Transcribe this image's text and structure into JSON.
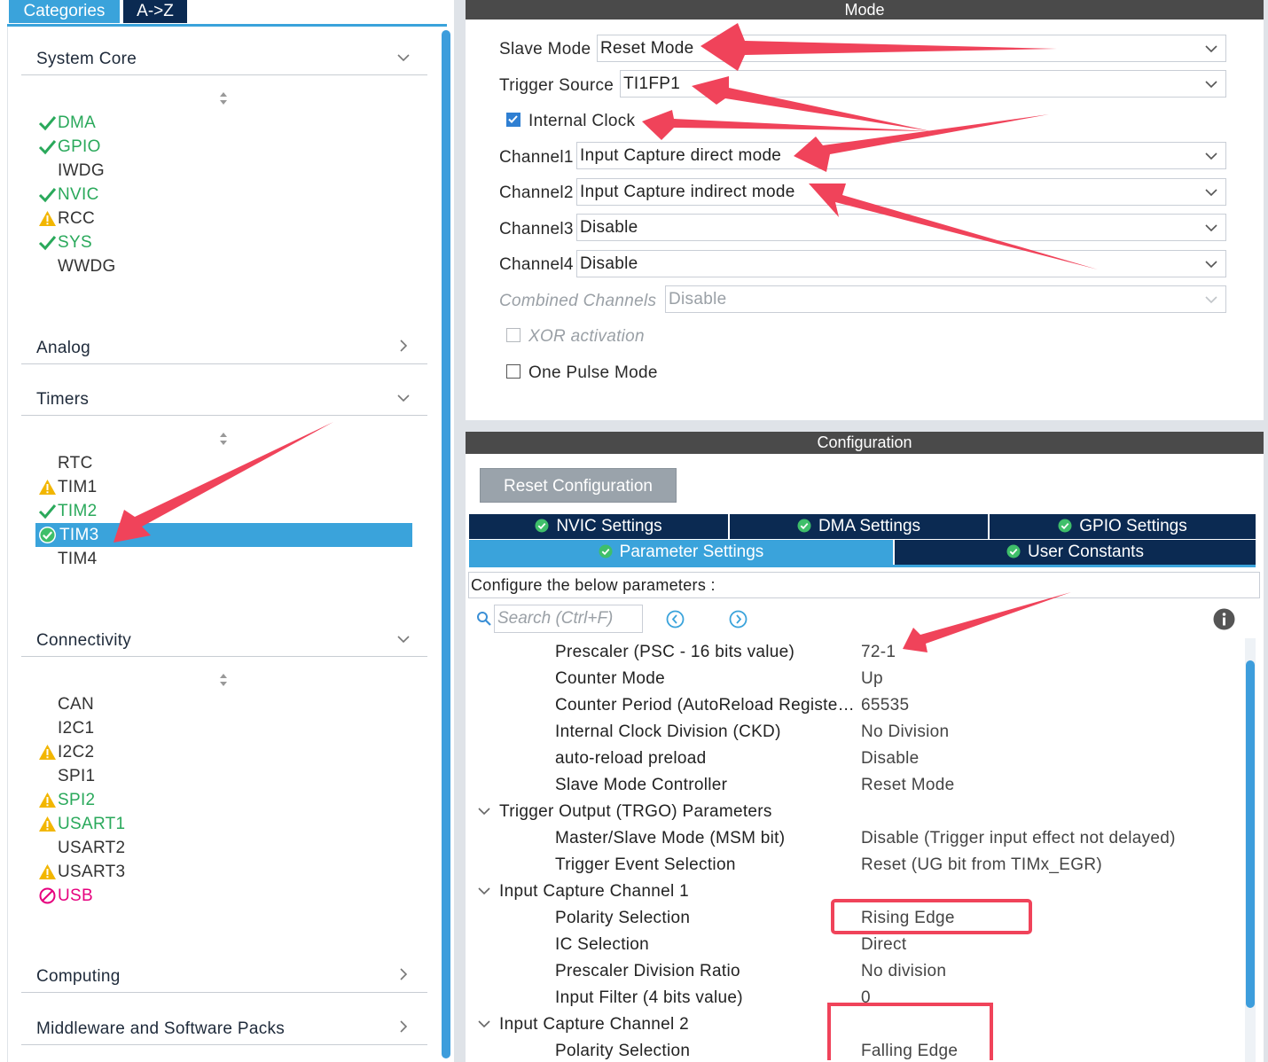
{
  "left_tabs": {
    "categories": "Categories",
    "az": "A->Z"
  },
  "sections": {
    "system_core": "System Core",
    "analog": "Analog",
    "timers": "Timers",
    "connectivity": "Connectivity",
    "computing": "Computing",
    "middleware": "Middleware and Software Packs"
  },
  "system_core_items": [
    {
      "label": "DMA",
      "status": "check"
    },
    {
      "label": "GPIO",
      "status": "check"
    },
    {
      "label": "IWDG",
      "status": "none"
    },
    {
      "label": "NVIC",
      "status": "check"
    },
    {
      "label": "RCC",
      "status": "warning"
    },
    {
      "label": "SYS",
      "status": "check"
    },
    {
      "label": "WWDG",
      "status": "none"
    }
  ],
  "timer_items": [
    {
      "label": "RTC",
      "status": "none"
    },
    {
      "label": "TIM1",
      "status": "warning"
    },
    {
      "label": "TIM2",
      "status": "check"
    },
    {
      "label": "TIM3",
      "status": "selected"
    },
    {
      "label": "TIM4",
      "status": "none"
    }
  ],
  "connectivity_items": [
    {
      "label": "CAN",
      "status": "none"
    },
    {
      "label": "I2C1",
      "status": "none"
    },
    {
      "label": "I2C2",
      "status": "warning"
    },
    {
      "label": "SPI1",
      "status": "none"
    },
    {
      "label": "SPI2",
      "status": "warning-green"
    },
    {
      "label": "USART1",
      "status": "warning-green"
    },
    {
      "label": "USART2",
      "status": "none"
    },
    {
      "label": "USART3",
      "status": "warning"
    },
    {
      "label": "USB",
      "status": "disabled"
    }
  ],
  "mode": {
    "header": "Mode",
    "slave_mode_label": "Slave Mode",
    "slave_mode_value": "Reset Mode",
    "trigger_source_label": "Trigger Source",
    "trigger_source_value": "TI1FP1",
    "internal_clock_label": "Internal Clock",
    "channel1_label": "Channel1",
    "channel1_value": "Input Capture direct mode",
    "channel2_label": "Channel2",
    "channel2_value": "Input Capture indirect mode",
    "channel3_label": "Channel3",
    "channel3_value": "Disable",
    "channel4_label": "Channel4",
    "channel4_value": "Disable",
    "combined_label": "Combined Channels",
    "combined_value": "Disable",
    "xor_label": "XOR activation",
    "one_pulse_label": "One Pulse Mode"
  },
  "configuration": {
    "header": "Configuration",
    "reset_button": "Reset Configuration",
    "tabs": {
      "nvic": "NVIC Settings",
      "dma": "DMA Settings",
      "gpio": "GPIO Settings",
      "parameter": "Parameter Settings",
      "user_constants": "User Constants"
    },
    "description": "Configure the below parameters :",
    "search_placeholder": "Search (Ctrl+F)"
  },
  "parameters": {
    "prescaler": {
      "name": "Prescaler (PSC - 16 bits value)",
      "value": "72-1"
    },
    "counter_mode": {
      "name": "Counter Mode",
      "value": "Up"
    },
    "counter_period": {
      "name": "Counter Period (AutoReload Registe…",
      "value": "65535"
    },
    "clock_division": {
      "name": "Internal Clock Division (CKD)",
      "value": "No Division"
    },
    "auto_reload": {
      "name": "auto-reload preload",
      "value": "Disable"
    },
    "slave_mode_controller": {
      "name": "Slave Mode Controller",
      "value": "Reset Mode"
    },
    "trgo_group": "Trigger Output (TRGO) Parameters",
    "msm": {
      "name": "Master/Slave Mode (MSM bit)",
      "value": "Disable (Trigger input effect not delayed)"
    },
    "trigger_event": {
      "name": "Trigger Event Selection",
      "value": "Reset (UG bit from TIMx_EGR)"
    },
    "ic1_group": "Input Capture Channel 1",
    "ic1_polarity": {
      "name": "Polarity Selection",
      "value": "Rising Edge"
    },
    "ic1_selection": {
      "name": "IC Selection",
      "value": "Direct"
    },
    "ic1_prescaler": {
      "name": "Prescaler Division Ratio",
      "value": "No division"
    },
    "ic1_filter": {
      "name": "Input Filter (4 bits value)",
      "value": "0"
    },
    "ic2_group": "Input Capture Channel 2",
    "ic2_polarity": {
      "name": "Polarity Selection",
      "value": "Falling Edge"
    }
  },
  "colors": {
    "accent_blue": "#3aa3db",
    "navy": "#0b2a52",
    "status_green": "#2aa95b",
    "warning_yellow": "#f2b600",
    "annotation_red": "#f0435a"
  }
}
